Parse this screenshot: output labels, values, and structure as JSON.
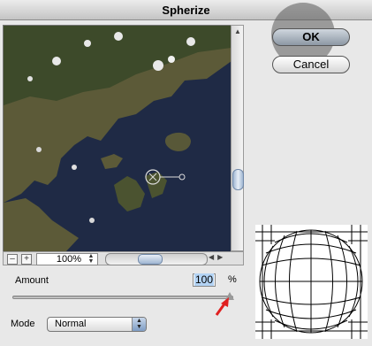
{
  "window": {
    "title": "Spherize"
  },
  "buttons": {
    "ok": "OK",
    "cancel": "Cancel"
  },
  "preview": {
    "minus_label": "–",
    "plus_label": "+",
    "zoom_value": "100%"
  },
  "amount": {
    "label": "Amount",
    "value": "100",
    "unit": "%"
  },
  "mode": {
    "label": "Mode",
    "value": "Normal"
  },
  "colors": {
    "sea": "#1f2a45",
    "land": "#5c5a38",
    "arrow": "#e02020",
    "ok_glow": "#5a5a5a"
  },
  "icons": [
    "zoom-out-icon",
    "zoom-in-icon",
    "stepper-icon",
    "scroll-arrow-icon",
    "target-crosshair-icon"
  ]
}
